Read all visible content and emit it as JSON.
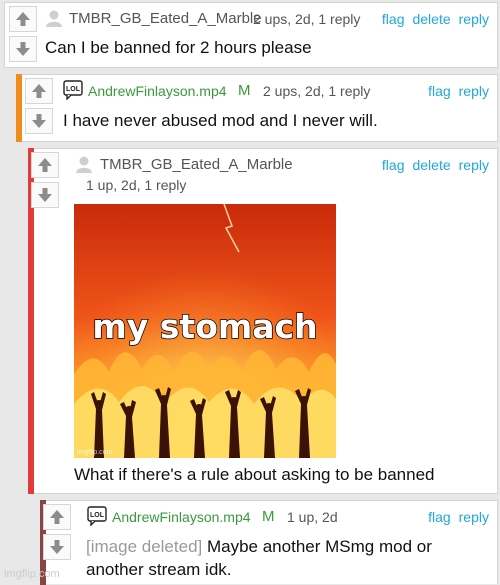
{
  "comments": [
    {
      "user": "TMBR_GB_Eated_A_Marble",
      "meta": "2 ups, 2d, 1 reply",
      "actions": [
        "flag",
        "delete",
        "reply"
      ],
      "text": "Can I be banned for 2 hours please"
    },
    {
      "user": "AndrewFinlayson.mp4",
      "badge": "M",
      "avatar_text": "LOL",
      "meta": "2 ups, 2d, 1 reply",
      "actions": [
        "flag",
        "reply"
      ],
      "text": "I have never abused mod and I never will."
    },
    {
      "user": "TMBR_GB_Eated_A_Marble",
      "meta": "1 up, 2d, 1 reply",
      "actions": [
        "flag",
        "delete",
        "reply"
      ],
      "image_caption": "my stomach",
      "image_watermark": "imgflip.com",
      "text": "What if there's a rule about asking to be banned"
    },
    {
      "user": "AndrewFinlayson.mp4",
      "badge": "M",
      "avatar_text": "LOL",
      "meta": "1 up, 2d",
      "actions": [
        "flag",
        "reply"
      ],
      "deleted_label": "[image deleted]",
      "text_line1": "Maybe another MSmg mod or",
      "text_line2": "another stream idk."
    }
  ],
  "watermark": "imgflip.com",
  "colors": {
    "link": "#1fa8d8",
    "mod_green": "#3a9a3a",
    "bar_orange": "#f08c1e",
    "bar_red": "#e23b3b",
    "bar_maroon": "#8a4444"
  }
}
